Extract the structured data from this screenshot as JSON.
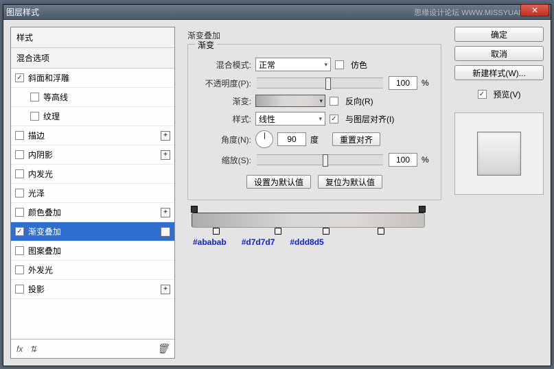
{
  "title": "图层样式",
  "watermark": "思缘设计论坛  WWW.MISSYUAN.COM",
  "closeGlyph": "✕",
  "sidebar": {
    "header1": "样式",
    "header2": "混合选项",
    "items": [
      {
        "label": "斜面和浮雕",
        "checked": true,
        "plus": false,
        "indent": false
      },
      {
        "label": "等高线",
        "checked": false,
        "plus": false,
        "indent": true
      },
      {
        "label": "纹理",
        "checked": false,
        "plus": false,
        "indent": true
      },
      {
        "label": "描边",
        "checked": false,
        "plus": true,
        "indent": false
      },
      {
        "label": "内阴影",
        "checked": false,
        "plus": true,
        "indent": false
      },
      {
        "label": "内发光",
        "checked": false,
        "plus": false,
        "indent": false
      },
      {
        "label": "光泽",
        "checked": false,
        "plus": false,
        "indent": false
      },
      {
        "label": "颜色叠加",
        "checked": false,
        "plus": true,
        "indent": false
      },
      {
        "label": "渐变叠加",
        "checked": true,
        "plus": true,
        "indent": false,
        "selected": true
      },
      {
        "label": "图案叠加",
        "checked": false,
        "plus": false,
        "indent": false
      },
      {
        "label": "外发光",
        "checked": false,
        "plus": false,
        "indent": false
      },
      {
        "label": "投影",
        "checked": false,
        "plus": true,
        "indent": false
      }
    ],
    "footFx": "fx",
    "footArrows": "⇅"
  },
  "content": {
    "title": "渐变叠加",
    "groupTitle": "渐变",
    "blendMode": {
      "label": "混合模式:",
      "value": "正常"
    },
    "dither": "仿色",
    "opacity": {
      "label": "不透明度(P):",
      "value": "100",
      "unit": "%"
    },
    "gradient": {
      "label": "渐变:"
    },
    "reverse": "反向(R)",
    "style": {
      "label": "样式:",
      "value": "线性"
    },
    "align": "与图层对齐(I)",
    "angle": {
      "label": "角度(N):",
      "value": "90",
      "unit": "度"
    },
    "resetAlign": "重置对齐",
    "scale": {
      "label": "缩放(S):",
      "value": "100",
      "unit": "%"
    },
    "setDefault": "设置为默认值",
    "resetDefault": "复位为默认值",
    "colors": [
      "#ababab",
      "#d7d7d7",
      "#ddd8d5"
    ]
  },
  "right": {
    "ok": "确定",
    "cancel": "取消",
    "newStyle": "新建样式(W)...",
    "preview": "预览(V)"
  }
}
